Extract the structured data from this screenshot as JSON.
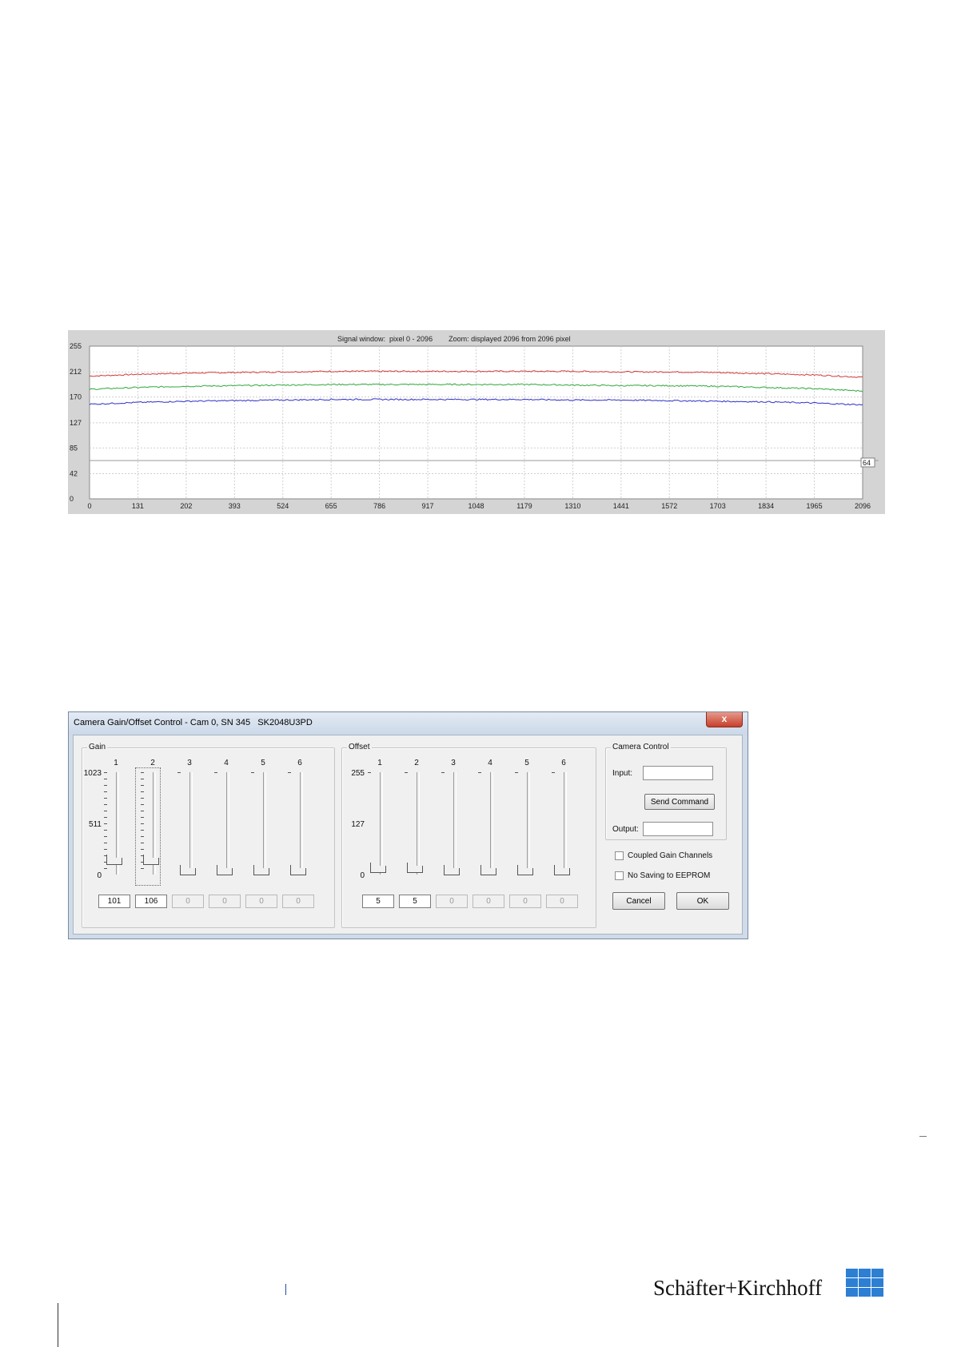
{
  "signal_chart": {
    "title": "Signal window:  pixel 0 - 2096        Zoom: displayed 2096 from 2096 pixel",
    "threshold_label": "64",
    "colors": {
      "red": "#d23a3a",
      "green": "#2fa83a",
      "blue": "#2f2fc8",
      "threshold": "#9a9a9a"
    }
  },
  "chart_data": {
    "type": "line",
    "title": "Signal window:  pixel 0 - 2096        Zoom: displayed 2096 from 2096 pixel",
    "xlabel": "",
    "ylabel": "",
    "x_ticks": [
      0,
      131,
      202,
      393,
      524,
      655,
      786,
      917,
      1048,
      1179,
      1310,
      1441,
      1572,
      1703,
      1834,
      1965,
      2096
    ],
    "y_ticks": [
      0,
      42,
      85,
      127,
      170,
      212,
      255
    ],
    "xlim": [
      0,
      2096
    ],
    "ylim": [
      0,
      255
    ],
    "grid": true,
    "threshold": 64,
    "x": [
      0,
      131,
      262,
      393,
      524,
      655,
      786,
      917,
      1048,
      1179,
      1310,
      1441,
      1572,
      1703,
      1834,
      1965,
      2096
    ],
    "series": [
      {
        "color": "red",
        "values": [
          205,
          208,
          210,
          211,
          212,
          213,
          213,
          213,
          213,
          213,
          213,
          212,
          212,
          211,
          209,
          207,
          203
        ]
      },
      {
        "color": "green",
        "values": [
          183,
          186,
          188,
          189,
          190,
          191,
          191,
          191,
          191,
          191,
          190,
          189,
          189,
          188,
          186,
          184,
          180
        ]
      },
      {
        "color": "blue",
        "values": [
          158,
          161,
          163,
          164,
          165,
          166,
          166,
          166,
          166,
          166,
          165,
          165,
          164,
          163,
          162,
          160,
          157
        ]
      }
    ]
  },
  "dialog": {
    "title": "Camera Gain/Offset Control - Cam 0, SN 345   SK2048U3PD",
    "close_label": "x",
    "gain": {
      "label": "Gain",
      "scale": [
        "1023",
        "511",
        "0"
      ],
      "channels": [
        {
          "num": "1",
          "value": "101",
          "enabled": true,
          "level": 0.099
        },
        {
          "num": "2",
          "value": "106",
          "enabled": true,
          "level": 0.104,
          "focused": true
        },
        {
          "num": "3",
          "value": "0",
          "enabled": false,
          "level": 0
        },
        {
          "num": "4",
          "value": "0",
          "enabled": false,
          "level": 0
        },
        {
          "num": "5",
          "value": "0",
          "enabled": false,
          "level": 0
        },
        {
          "num": "6",
          "value": "0",
          "enabled": false,
          "level": 0
        }
      ]
    },
    "offset": {
      "label": "Offset",
      "scale": [
        "255",
        "127",
        "0"
      ],
      "channels": [
        {
          "num": "1",
          "value": "5",
          "enabled": true,
          "level": 0.02
        },
        {
          "num": "2",
          "value": "5",
          "enabled": true,
          "level": 0.02
        },
        {
          "num": "3",
          "value": "0",
          "enabled": false,
          "level": 0
        },
        {
          "num": "4",
          "value": "0",
          "enabled": false,
          "level": 0
        },
        {
          "num": "5",
          "value": "0",
          "enabled": false,
          "level": 0
        },
        {
          "num": "6",
          "value": "0",
          "enabled": false,
          "level": 0
        }
      ]
    },
    "camera_control": {
      "label": "Camera Control",
      "input_label": "Input:",
      "input_value": "",
      "send_label": "Send Command",
      "output_label": "Output:",
      "output_value": ""
    },
    "coupled_label": "Coupled Gain Channels",
    "coupled_checked": false,
    "no_saving_label": "No Saving to EEPROM",
    "no_saving_checked": false,
    "cancel_label": "Cancel",
    "ok_label": "OK"
  },
  "footer": {
    "brand": "Schäfter+Kirchhoff",
    "logo_color": "#2d7fd3"
  }
}
